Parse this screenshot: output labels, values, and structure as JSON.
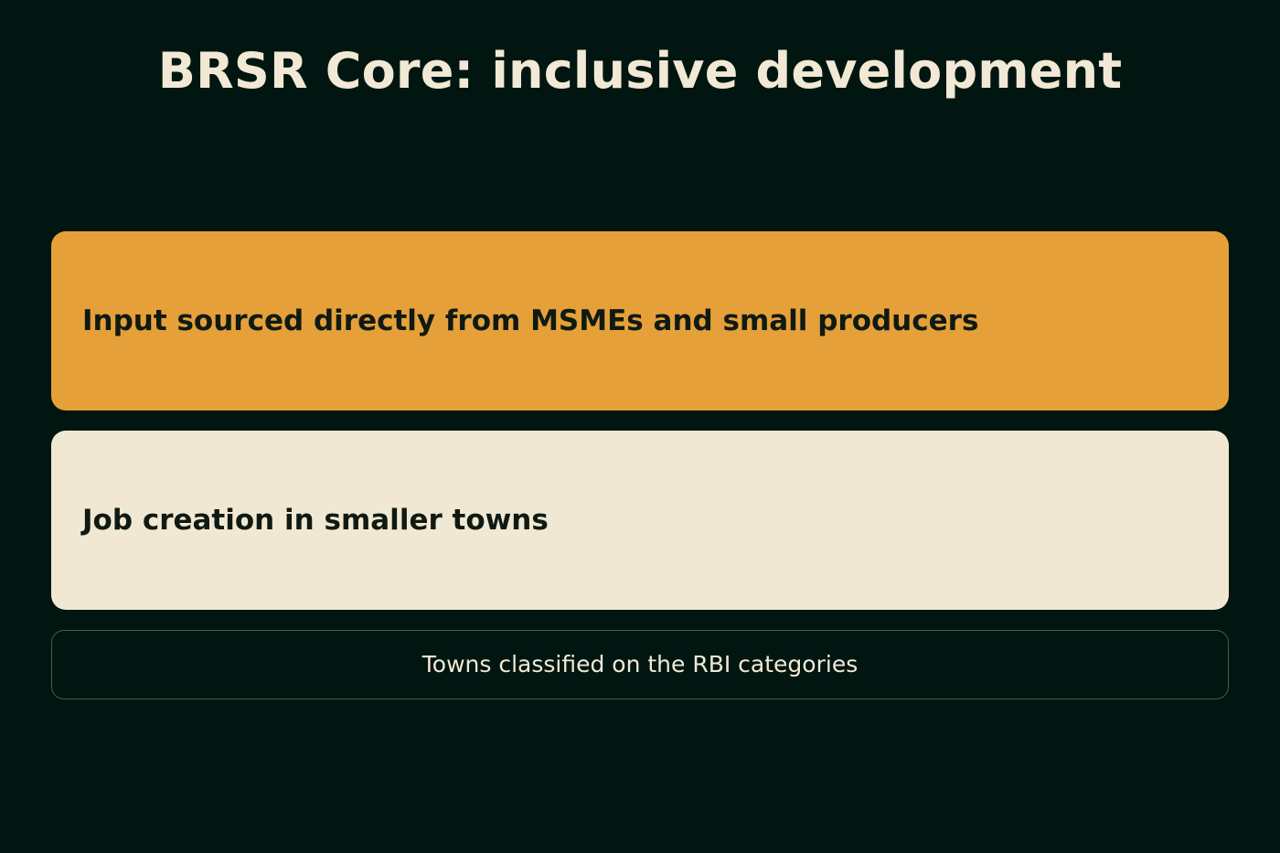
{
  "slide": {
    "title": "BRSR Core: inclusive development",
    "cards": [
      {
        "label": "Input sourced directly from MSMEs and small producers",
        "color": "#e5a03a"
      },
      {
        "label": "Job creation in smaller towns",
        "color": "#f1e8d4"
      }
    ],
    "footnote": "Towns classified on the RBI categories"
  },
  "colors": {
    "background": "#011610",
    "title_text": "#f1e9d5",
    "card_text": "#0f1a12",
    "footnote_border": "#4a5a52"
  }
}
